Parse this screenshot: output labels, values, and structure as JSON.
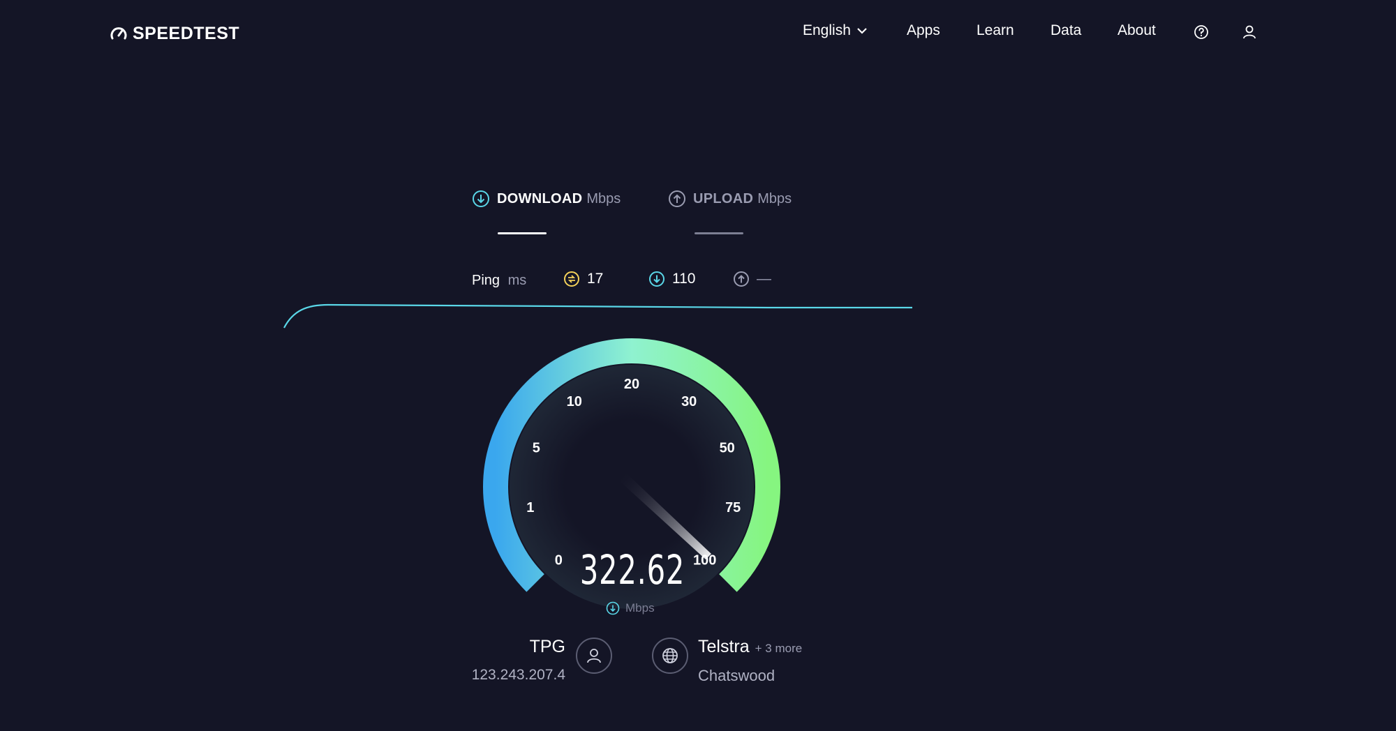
{
  "header": {
    "logo_text": "SPEEDTEST",
    "nav": {
      "language": "English",
      "apps": "Apps",
      "learn": "Learn",
      "data": "Data",
      "about": "About"
    }
  },
  "tabs": {
    "download": {
      "label": "DOWNLOAD",
      "unit": "Mbps"
    },
    "upload": {
      "label": "UPLOAD",
      "unit": "Mbps"
    }
  },
  "ping": {
    "label": "Ping",
    "unit": "ms",
    "idle": "17",
    "download": "110",
    "upload": "—"
  },
  "gauge": {
    "ticks": [
      "0",
      "1",
      "5",
      "10",
      "20",
      "30",
      "50",
      "75",
      "100"
    ],
    "value": "322.62",
    "unit": "Mbps",
    "needle_label": "100"
  },
  "isp": {
    "name": "TPG",
    "ip": "123.243.207.4"
  },
  "server": {
    "name": "Telstra",
    "more": "+ 3 more",
    "location": "Chatswood"
  },
  "colors": {
    "background": "#141526",
    "gauge_start": "#3aa7ee",
    "gauge_mid": "#8ff2d0",
    "gauge_end": "#86f580",
    "accent_cyan": "#5ad7e8",
    "ping_yellow": "#f5d25a",
    "muted": "#9a9cb1"
  }
}
